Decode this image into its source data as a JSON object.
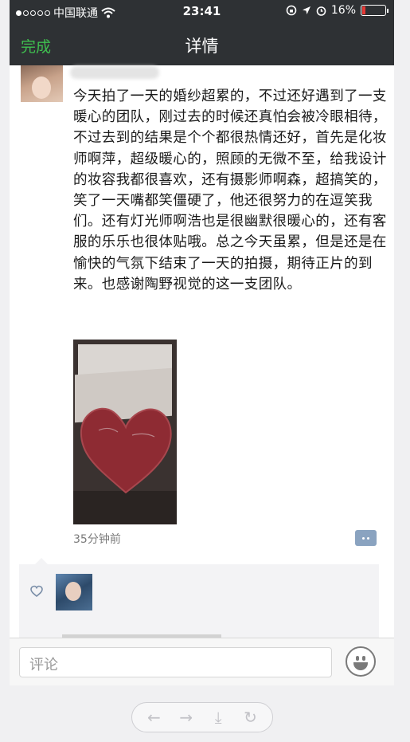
{
  "status_bar": {
    "carrier": "中国联通",
    "time": "23:41",
    "battery": "16%",
    "battery_level": 0.16
  },
  "navbar": {
    "done_label": "完成",
    "title": "详情"
  },
  "post": {
    "text": "今天拍了一天的婚纱超累的，不过还好遇到了一支暖心的团队，刚过去的时候还真怕会被冷眼相待，不过去到的结果是个个都很热情还好，首先是化妆师啊萍，超级暖心的，照顾的无微不至，给我设计的妆容我都很喜欢，还有摄影师啊森，超搞笑的，笑了一天嘴都笑僵硬了，他还很努力的在逗笑我们。还有灯光师啊浩也是很幽默很暖心的，还有客服的乐乐也很体贴哦。总之今天虽累，但是还是在愉快的气氛下结束了一天的拍摄，期待正片的到来。也感谢陶野视觉的这一支团队。",
    "timestamp": "35分钟前"
  },
  "comment_input": {
    "placeholder": "评论"
  },
  "icons": {
    "wifi": "wifi-icon",
    "heart": "heart-icon",
    "comment": "comment-icon",
    "emoji": "emoji-icon",
    "back": "back-arrow-icon",
    "forward": "forward-arrow-icon",
    "download": "download-icon",
    "refresh": "refresh-icon"
  },
  "colors": {
    "navbar_bg": "#2e3134",
    "done_green": "#3fbf4f",
    "comment_button": "#8aa3c0"
  }
}
